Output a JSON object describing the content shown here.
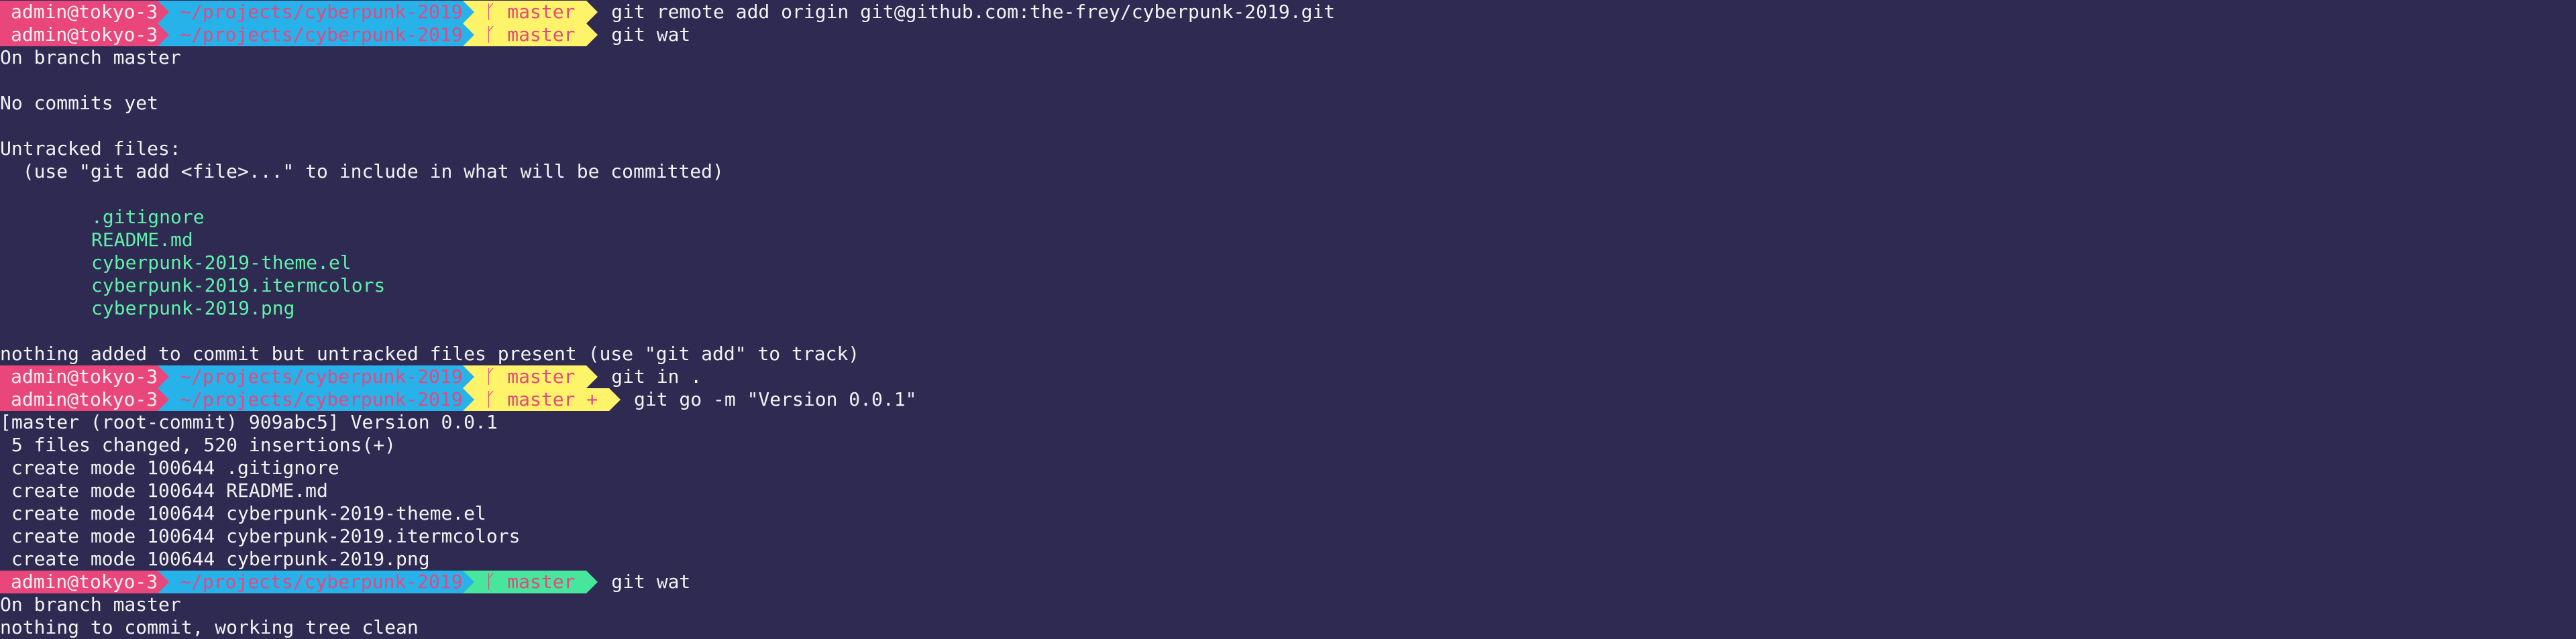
{
  "prompt": {
    "user": "admin@tokyo-3",
    "path": "~/projects/cyberpunk-2019",
    "branch_symbol": "ᚴ",
    "branch": "master",
    "dirty_marker": "+",
    "colors": {
      "background": "#2f2a52",
      "user_bg": "#e9477b",
      "path_bg": "#27b2ea",
      "branch_bg": "#fff36a",
      "branch_clean_bg": "#48e59c",
      "file_text": "#5ff0aa"
    }
  },
  "commands": [
    "git remote add origin git@github.com:the-frey/cyberpunk-2019.git",
    "git wat",
    "git in .",
    "git go -m \"Version 0.0.1\"",
    "git wat"
  ],
  "status1": {
    "on_branch": "On branch master",
    "no_commits": "No commits yet",
    "untracked_header": "Untracked files:",
    "hint": "  (use \"git add <file>...\" to include in what will be committed)",
    "files": [
      ".gitignore",
      "README.md",
      "cyberpunk-2019-theme.el",
      "cyberpunk-2019.itermcolors",
      "cyberpunk-2019.png"
    ],
    "footer": "nothing added to commit but untracked files present (use \"git add\" to track)"
  },
  "commit_output": [
    "[master (root-commit) 909abc5] Version 0.0.1",
    " 5 files changed, 520 insertions(+)",
    " create mode 100644 .gitignore",
    " create mode 100644 README.md",
    " create mode 100644 cyberpunk-2019-theme.el",
    " create mode 100644 cyberpunk-2019.itermcolors",
    " create mode 100644 cyberpunk-2019.png"
  ],
  "status2": {
    "on_branch": "On branch master",
    "clean": "nothing to commit, working tree clean"
  }
}
